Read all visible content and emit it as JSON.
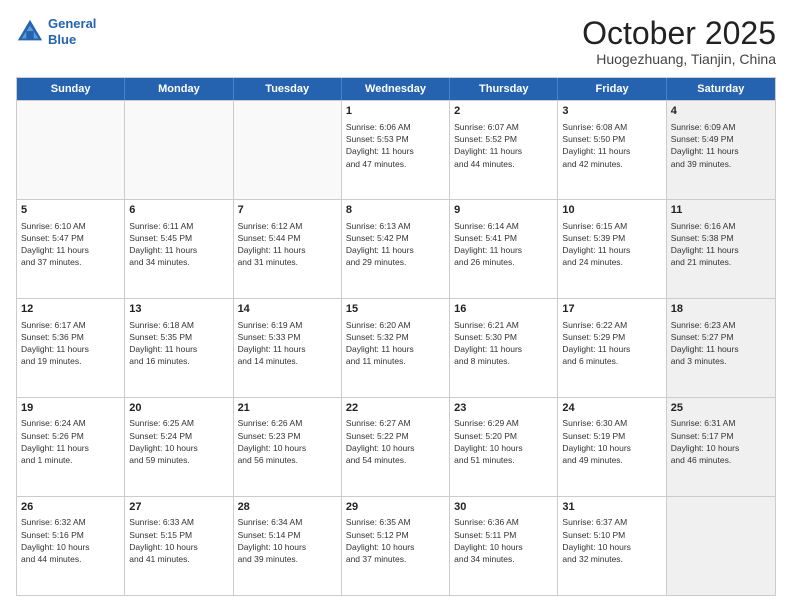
{
  "header": {
    "logo_line1": "General",
    "logo_line2": "Blue",
    "month": "October 2025",
    "location": "Huogezhuang, Tianjin, China"
  },
  "weekdays": [
    "Sunday",
    "Monday",
    "Tuesday",
    "Wednesday",
    "Thursday",
    "Friday",
    "Saturday"
  ],
  "rows": [
    [
      {
        "day": "",
        "text": "",
        "empty": true
      },
      {
        "day": "",
        "text": "",
        "empty": true
      },
      {
        "day": "",
        "text": "",
        "empty": true
      },
      {
        "day": "1",
        "text": "Sunrise: 6:06 AM\nSunset: 5:53 PM\nDaylight: 11 hours\nand 47 minutes."
      },
      {
        "day": "2",
        "text": "Sunrise: 6:07 AM\nSunset: 5:52 PM\nDaylight: 11 hours\nand 44 minutes."
      },
      {
        "day": "3",
        "text": "Sunrise: 6:08 AM\nSunset: 5:50 PM\nDaylight: 11 hours\nand 42 minutes."
      },
      {
        "day": "4",
        "text": "Sunrise: 6:09 AM\nSunset: 5:49 PM\nDaylight: 11 hours\nand 39 minutes.",
        "shaded": true
      }
    ],
    [
      {
        "day": "5",
        "text": "Sunrise: 6:10 AM\nSunset: 5:47 PM\nDaylight: 11 hours\nand 37 minutes."
      },
      {
        "day": "6",
        "text": "Sunrise: 6:11 AM\nSunset: 5:45 PM\nDaylight: 11 hours\nand 34 minutes."
      },
      {
        "day": "7",
        "text": "Sunrise: 6:12 AM\nSunset: 5:44 PM\nDaylight: 11 hours\nand 31 minutes."
      },
      {
        "day": "8",
        "text": "Sunrise: 6:13 AM\nSunset: 5:42 PM\nDaylight: 11 hours\nand 29 minutes."
      },
      {
        "day": "9",
        "text": "Sunrise: 6:14 AM\nSunset: 5:41 PM\nDaylight: 11 hours\nand 26 minutes."
      },
      {
        "day": "10",
        "text": "Sunrise: 6:15 AM\nSunset: 5:39 PM\nDaylight: 11 hours\nand 24 minutes."
      },
      {
        "day": "11",
        "text": "Sunrise: 6:16 AM\nSunset: 5:38 PM\nDaylight: 11 hours\nand 21 minutes.",
        "shaded": true
      }
    ],
    [
      {
        "day": "12",
        "text": "Sunrise: 6:17 AM\nSunset: 5:36 PM\nDaylight: 11 hours\nand 19 minutes."
      },
      {
        "day": "13",
        "text": "Sunrise: 6:18 AM\nSunset: 5:35 PM\nDaylight: 11 hours\nand 16 minutes."
      },
      {
        "day": "14",
        "text": "Sunrise: 6:19 AM\nSunset: 5:33 PM\nDaylight: 11 hours\nand 14 minutes."
      },
      {
        "day": "15",
        "text": "Sunrise: 6:20 AM\nSunset: 5:32 PM\nDaylight: 11 hours\nand 11 minutes."
      },
      {
        "day": "16",
        "text": "Sunrise: 6:21 AM\nSunset: 5:30 PM\nDaylight: 11 hours\nand 8 minutes."
      },
      {
        "day": "17",
        "text": "Sunrise: 6:22 AM\nSunset: 5:29 PM\nDaylight: 11 hours\nand 6 minutes."
      },
      {
        "day": "18",
        "text": "Sunrise: 6:23 AM\nSunset: 5:27 PM\nDaylight: 11 hours\nand 3 minutes.",
        "shaded": true
      }
    ],
    [
      {
        "day": "19",
        "text": "Sunrise: 6:24 AM\nSunset: 5:26 PM\nDaylight: 11 hours\nand 1 minute."
      },
      {
        "day": "20",
        "text": "Sunrise: 6:25 AM\nSunset: 5:24 PM\nDaylight: 10 hours\nand 59 minutes."
      },
      {
        "day": "21",
        "text": "Sunrise: 6:26 AM\nSunset: 5:23 PM\nDaylight: 10 hours\nand 56 minutes."
      },
      {
        "day": "22",
        "text": "Sunrise: 6:27 AM\nSunset: 5:22 PM\nDaylight: 10 hours\nand 54 minutes."
      },
      {
        "day": "23",
        "text": "Sunrise: 6:29 AM\nSunset: 5:20 PM\nDaylight: 10 hours\nand 51 minutes."
      },
      {
        "day": "24",
        "text": "Sunrise: 6:30 AM\nSunset: 5:19 PM\nDaylight: 10 hours\nand 49 minutes."
      },
      {
        "day": "25",
        "text": "Sunrise: 6:31 AM\nSunset: 5:17 PM\nDaylight: 10 hours\nand 46 minutes.",
        "shaded": true
      }
    ],
    [
      {
        "day": "26",
        "text": "Sunrise: 6:32 AM\nSunset: 5:16 PM\nDaylight: 10 hours\nand 44 minutes."
      },
      {
        "day": "27",
        "text": "Sunrise: 6:33 AM\nSunset: 5:15 PM\nDaylight: 10 hours\nand 41 minutes."
      },
      {
        "day": "28",
        "text": "Sunrise: 6:34 AM\nSunset: 5:14 PM\nDaylight: 10 hours\nand 39 minutes."
      },
      {
        "day": "29",
        "text": "Sunrise: 6:35 AM\nSunset: 5:12 PM\nDaylight: 10 hours\nand 37 minutes."
      },
      {
        "day": "30",
        "text": "Sunrise: 6:36 AM\nSunset: 5:11 PM\nDaylight: 10 hours\nand 34 minutes."
      },
      {
        "day": "31",
        "text": "Sunrise: 6:37 AM\nSunset: 5:10 PM\nDaylight: 10 hours\nand 32 minutes."
      },
      {
        "day": "",
        "text": "",
        "empty": true,
        "shaded": true
      }
    ]
  ]
}
